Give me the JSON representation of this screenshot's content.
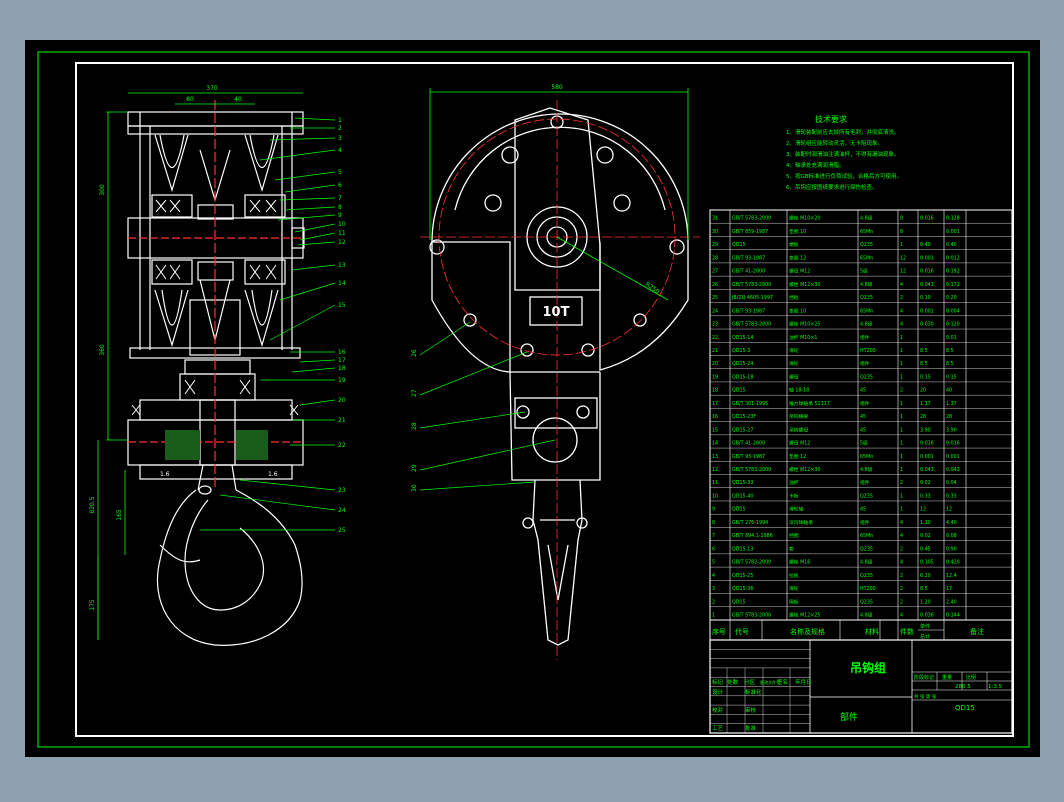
{
  "colors": {
    "background": "#000000",
    "frame": "#ffffff",
    "outer_frame": "#00ff00",
    "geometry": "#ffffff",
    "dimension": "#00ff00",
    "annotation": "#00ff00",
    "centerline": "#ff3030",
    "hatch": "#ffffff",
    "fill_green": "#1a5c1a",
    "window_bg": "#8fa0b0"
  },
  "drawing": {
    "title": "吊钩组",
    "part_label": "部件",
    "drawing_code": "QD15",
    "tech_req_title": "技术要求",
    "tech_req": [
      "1、滑轮装配前应去掉所有毛刺，并彻底清洗。",
      "2、滑轮组应能转动灵活，无卡阻现象。",
      "3、装配时润滑油注满油杯，不得有漏油现象。",
      "4、轴承处充满润滑脂。",
      "5、按GB标准进行负荷试验，合格后方可使用。",
      "6、吊钩应按图纸要求进行探伤检查。"
    ],
    "left_view": {
      "dims": [
        "370",
        "80",
        "40",
        "300",
        "360",
        "820.5",
        "165",
        "175"
      ],
      "numbers": [
        "1",
        "2",
        "3",
        "4",
        "5",
        "6",
        "7",
        "8",
        "9",
        "10",
        "11",
        "12",
        "13",
        "14",
        "15",
        "16",
        "17",
        "18",
        "19",
        "20",
        "21",
        "22",
        "23",
        "24",
        "25"
      ],
      "marks": [
        "1.6",
        "1.6"
      ]
    },
    "right_view": {
      "dims": [
        "580",
        "R250"
      ],
      "plate_label": "10T",
      "numbers": [
        "26",
        "27",
        "28",
        "29",
        "30"
      ]
    },
    "parts_header": [
      "序号",
      "代号",
      "名称及规格",
      "材料",
      "件数",
      "单件",
      "总计",
      "备注"
    ],
    "parts_rows": [
      [
        "31",
        "GB/T 5783-2000",
        "螺栓 M10×20",
        "4.8级",
        "8",
        "0.016",
        "0.128"
      ],
      [
        "30",
        "GB/T 859-1987",
        "垫圈 10",
        "65Mn",
        "8",
        "",
        "0.001"
      ],
      [
        "29",
        "QD15",
        "端板",
        "Q235",
        "1",
        "0.40",
        "0.40"
      ],
      [
        "28",
        "GB/T 93-1987",
        "垫圈 12",
        "65Mn",
        "12",
        "0.001",
        "0.012"
      ],
      [
        "27",
        "GB/T 41-2000",
        "螺母 M12",
        "5级",
        "12",
        "0.016",
        "0.192"
      ],
      [
        "26",
        "GB/T 5783-2000",
        "螺栓 M12×30",
        "4.8级",
        "4",
        "0.043",
        "0.172"
      ],
      [
        "25",
        "JB/ZQ 4605-1997",
        "挡板",
        "Q235",
        "2",
        "0.10",
        "0.20"
      ],
      [
        "24",
        "GB/T 93-1987",
        "垫圈 10",
        "65Mn",
        "4",
        "0.001",
        "0.004"
      ],
      [
        "23",
        "GB/T 5783-2000",
        "螺栓 M10×25",
        "4.8级",
        "4",
        "0.030",
        "0.120"
      ],
      [
        "22",
        "QD15-14",
        "油杯 M10×1",
        "组件",
        "1",
        "",
        "0.01"
      ],
      [
        "21",
        "QD15-3",
        "滑轮",
        "HT200",
        "1",
        "8.5",
        "8.5"
      ],
      [
        "20",
        "QD15-24",
        "滑轮",
        "组件",
        "1",
        "8.5",
        "8.5"
      ],
      [
        "19",
        "QD15-18",
        "螺母",
        "Q235",
        "1",
        "0.15",
        "0.15"
      ],
      [
        "18",
        "QD15",
        "轴 18-18",
        "45",
        "2",
        "20",
        "40"
      ],
      [
        "17",
        "GB/T 301-1995",
        "推力球轴承 51317",
        "组件",
        "1",
        "1.37",
        "1.37"
      ],
      [
        "16",
        "QD15-23F",
        "吊钩横梁",
        "45",
        "1",
        "28",
        "28"
      ],
      [
        "15",
        "QD15-27",
        "吊钩螺母",
        "45",
        "1",
        "3.90",
        "3.90"
      ],
      [
        "14",
        "GB/T 41-2000",
        "螺母 M12",
        "5级",
        "1",
        "0.016",
        "0.016"
      ],
      [
        "13",
        "GB/T 93-1987",
        "垫圈 12",
        "65Mn",
        "1",
        "0.001",
        "0.001"
      ],
      [
        "12",
        "GB/T 5783-2000",
        "螺栓 M12×30",
        "4.8级",
        "1",
        "0.043",
        "0.043"
      ],
      [
        "11",
        "QD15-33",
        "油杯",
        "组件",
        "2",
        "0.02",
        "0.04"
      ],
      [
        "10",
        "QD15-40",
        "卡板",
        "Q235",
        "1",
        "0.33",
        "0.33"
      ],
      [
        "9",
        "QD15",
        "滑轮轴",
        "45",
        "1",
        "12",
        "12"
      ],
      [
        "8",
        "GB/T 276-1994",
        "深沟球轴承",
        "组件",
        "4",
        "1.10",
        "4.40"
      ],
      [
        "7",
        "GB/T 894.1-1986",
        "挡圈",
        "65Mn",
        "4",
        "0.02",
        "0.08"
      ],
      [
        "6",
        "QD15-13",
        "套",
        "Q235",
        "2",
        "0.45",
        "0.90"
      ],
      [
        "5",
        "GB/T 5782-2000",
        "螺栓 M16",
        "4.8级",
        "4",
        "0.105",
        "0.420"
      ],
      [
        "4",
        "QD15-25",
        "拉板",
        "Q235",
        "2",
        "6.20",
        "12.4"
      ],
      [
        "3",
        "QD15-36",
        "滑轮",
        "HT200",
        "2",
        "8.5",
        "17"
      ],
      [
        "2",
        "QD15",
        "隔板",
        "Q235",
        "2",
        "1.20",
        "2.40"
      ],
      [
        "1",
        "GB/T 5783-2000",
        "螺栓 M12×25",
        "4.8级",
        "4",
        "0.036",
        "0.144"
      ]
    ],
    "title_block": {
      "labels": [
        "标记",
        "处数",
        "分区",
        "更改文件号",
        "签名",
        "年月日",
        "设计",
        "标准化",
        "校对",
        "审核",
        "工艺",
        "批准"
      ],
      "stage_labels": [
        "阶段标记",
        "重量",
        "比例"
      ],
      "weight": "280.5",
      "scale": "1:3.5",
      "sheet": "共 张 第 张"
    }
  }
}
